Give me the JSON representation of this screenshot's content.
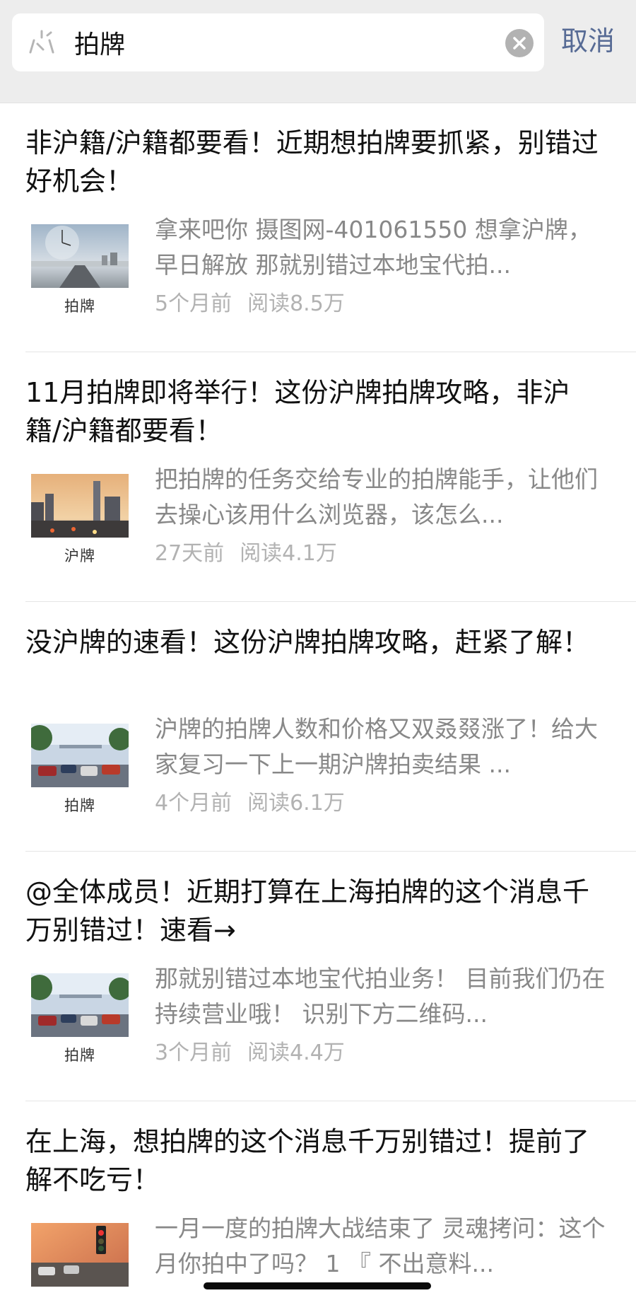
{
  "search": {
    "query": "拍牌",
    "cancel_label": "取消"
  },
  "results": [
    {
      "title": "非沪籍/沪籍都要看！近期想拍牌要抓紧，别错过好机会！",
      "digest": "拿来吧你 摄图网-401061550 想拿沪牌，早日解放 那就别错过本地宝代拍...",
      "time": "5个月前",
      "reads": "阅读8.5万",
      "thumb_caption": "拍牌",
      "thumb_icon": "clock-road-image"
    },
    {
      "title": "11月拍牌即将举行！这份沪牌拍牌攻略，非沪籍/沪籍都要看！",
      "digest": "把拍牌的任务交给专业的拍牌能手，让他们去操心该用什么浏览器，该怎么...",
      "time": "27天前",
      "reads": "阅读4.1万",
      "thumb_caption": "沪牌",
      "thumb_icon": "city-traffic-image"
    },
    {
      "title": "没沪牌的速看！这份沪牌拍牌攻略，赶紧了解！",
      "digest": "沪牌的拍牌人数和价格又双叒叕涨了！给大家复习一下上一期沪牌拍卖结果 ...",
      "time": "4个月前",
      "reads": "阅读6.1万",
      "thumb_caption": "拍牌",
      "thumb_icon": "cars-street-image"
    },
    {
      "title": "@全体成员！近期打算在上海拍牌的这个消息千万别错过！速看→",
      "digest": "那就别错过本地宝代拍业务！ 目前我们仍在持续营业哦！ 识别下方二维码...",
      "time": "3个月前",
      "reads": "阅读4.4万",
      "thumb_caption": "拍牌",
      "thumb_icon": "cars-street-image"
    },
    {
      "title": "在上海，想拍牌的这个消息千万别错过！提前了解不吃亏！",
      "digest": "一月一度的拍牌大战结束了 灵魂拷问：这个月你拍中了吗？ 1 『 不出意料...",
      "time": "",
      "reads": "",
      "thumb_caption": "",
      "thumb_icon": "traffic-light-image"
    }
  ]
}
